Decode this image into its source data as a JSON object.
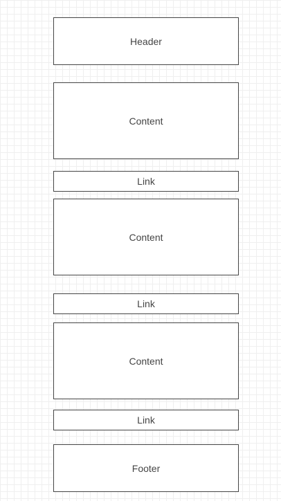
{
  "wireframe": {
    "header": "Header",
    "content_1": "Content",
    "link_1": "Link",
    "content_2": "Content",
    "link_2": "Link",
    "content_3": "Content",
    "link_3": "Link",
    "footer": "Footer"
  }
}
